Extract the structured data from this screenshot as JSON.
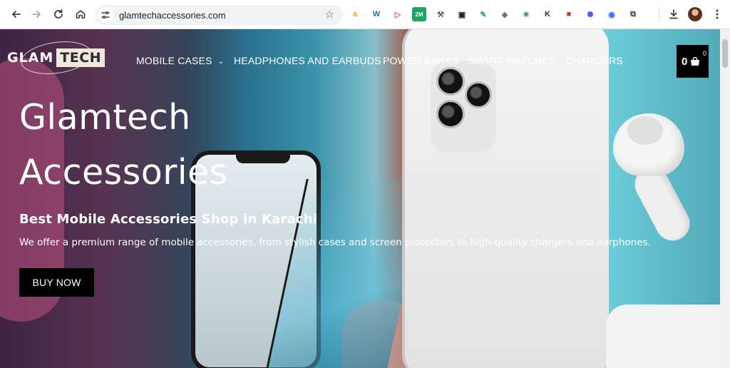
{
  "browser": {
    "url": "glamtechaccessories.com",
    "nav": {
      "back_icon": "arrow-left-icon",
      "forward_icon": "arrow-right-icon",
      "reload_icon": "reload-icon",
      "home_icon": "home-icon"
    },
    "extensions": [
      {
        "name": "amazon-assistant-icon",
        "glyph": "a",
        "color": "#ff9900"
      },
      {
        "name": "wordpress-icon",
        "glyph": "W",
        "color": "#21759b"
      },
      {
        "name": "arrow-extension-icon",
        "glyph": "▷",
        "color": "#e84a8a"
      },
      {
        "name": "badge-extension-icon",
        "glyph": "2M",
        "color": "#1da462"
      },
      {
        "name": "tools-extension-icon",
        "glyph": "⚒",
        "color": "#5a5a5a"
      },
      {
        "name": "contacts-extension-icon",
        "glyph": "▣",
        "color": "#202124"
      },
      {
        "name": "dropper-extension-icon",
        "glyph": "✎",
        "color": "#2a9d8f"
      },
      {
        "name": "shield-extension-icon",
        "glyph": "◈",
        "color": "#5f6b8a"
      },
      {
        "name": "sparkle-extension-icon",
        "glyph": "✳",
        "color": "#1e8e3e"
      },
      {
        "name": "k-extension-icon",
        "glyph": "K",
        "color": "#3b1f3b"
      },
      {
        "name": "color-picker-extension-icon",
        "glyph": "■",
        "color": "#c0392b"
      },
      {
        "name": "gear-extension-icon",
        "glyph": "✺",
        "color": "#4a5af0"
      },
      {
        "name": "screen-recorder-extension-icon",
        "glyph": "◉",
        "color": "#3b6cf6"
      },
      {
        "name": "extensions-puzzle-icon",
        "glyph": "⧉",
        "color": "#3c4043"
      }
    ],
    "download_icon": "download-icon",
    "menu_icon": "kebab-menu-icon"
  },
  "site": {
    "logo": {
      "part1": "GLAM",
      "part2": "TECH"
    },
    "menu": [
      {
        "label": "MOBILE CASES",
        "has_dropdown": true
      },
      {
        "label": "HEADPHONES AND EARBUDS",
        "has_dropdown": false
      },
      {
        "label": "POWER BANKS",
        "has_dropdown": false
      },
      {
        "label": "SMART WATCHES",
        "has_dropdown": false
      },
      {
        "label": "CHARGERS",
        "has_dropdown": false
      }
    ],
    "cart": {
      "count": "0",
      "badge": "0"
    }
  },
  "hero": {
    "title_line1": "Glamtech",
    "title_line2": "Accessories",
    "subtitle": "Best Mobile Accessories Shop in Karachi",
    "description": "We offer a premium range of mobile accessories, from stylish cases and screen protectors to high-quality chargers and earphones.",
    "button": "BUY NOW"
  }
}
